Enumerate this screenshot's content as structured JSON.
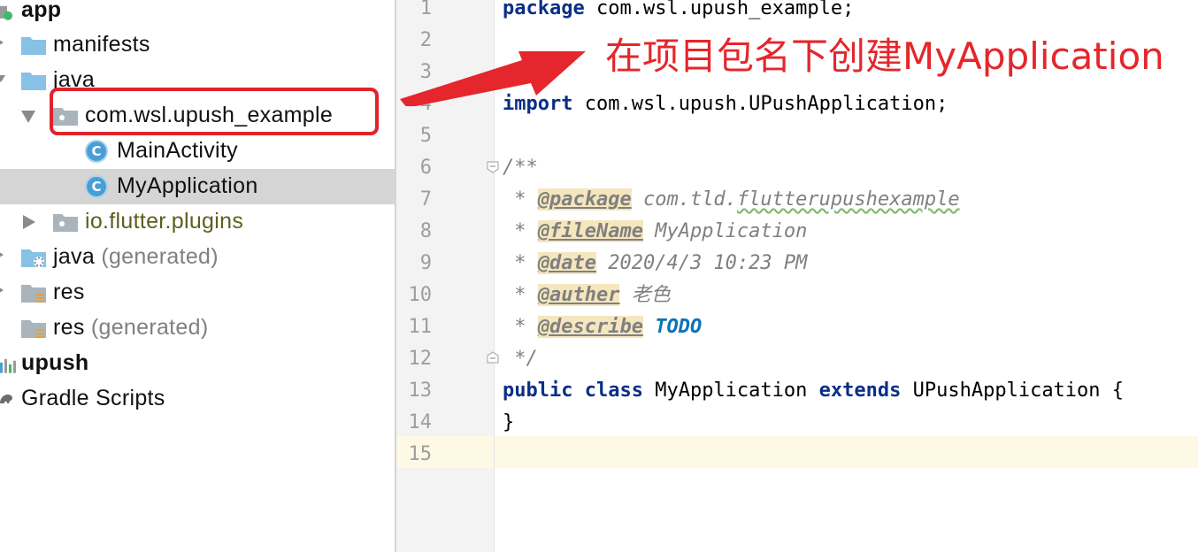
{
  "tree": {
    "items": [
      {
        "label": "app"
      },
      {
        "label": "manifests"
      },
      {
        "label": "java"
      },
      {
        "label": "com.wsl.upush_example"
      },
      {
        "label": "MainActivity",
        "icon_letter": "C"
      },
      {
        "label": "MyApplication",
        "icon_letter": "C"
      },
      {
        "label": "io.flutter.plugins"
      },
      {
        "label": "java",
        "suffix": "(generated)"
      },
      {
        "label": "res"
      },
      {
        "label": "res",
        "suffix": "(generated)"
      },
      {
        "label": "upush"
      },
      {
        "label": "Gradle Scripts"
      }
    ]
  },
  "editor": {
    "line_numbers": [
      "1",
      "2",
      "3",
      "4",
      "5",
      "6",
      "7",
      "8",
      "9",
      "10",
      "11",
      "12",
      "13",
      "14",
      "15"
    ],
    "l1": {
      "kw": "package",
      "rest": " com.wsl.upush_example;"
    },
    "l4": {
      "kw": "import",
      "rest": " com.wsl.upush.UPushApplication;"
    },
    "l6": {
      "text": "/**"
    },
    "l7": {
      "star": " * ",
      "tag": "@package",
      "rest_a": " com.tld.",
      "rest_b": "flutterupushexample"
    },
    "l8": {
      "star": " * ",
      "tag": "@fileName",
      "rest": " MyApplication"
    },
    "l9": {
      "star": " * ",
      "tag": "@date",
      "rest": " 2020/4/3 10:23 PM"
    },
    "l10": {
      "star": " * ",
      "tag": "@auther",
      "rest": " 老色"
    },
    "l11": {
      "star": " * ",
      "tag": "@describe",
      "todo": " TODO"
    },
    "l12": {
      "text": " */"
    },
    "l13": {
      "kw1": "public",
      "kw2": " class",
      "mid": " MyApplication ",
      "kw3": "extends",
      "rest": " UPushApplication {"
    },
    "l14": {
      "text": "}"
    }
  },
  "annotation": {
    "text": "在项目包名下创建MyApplication",
    "color": "#e5262c"
  }
}
